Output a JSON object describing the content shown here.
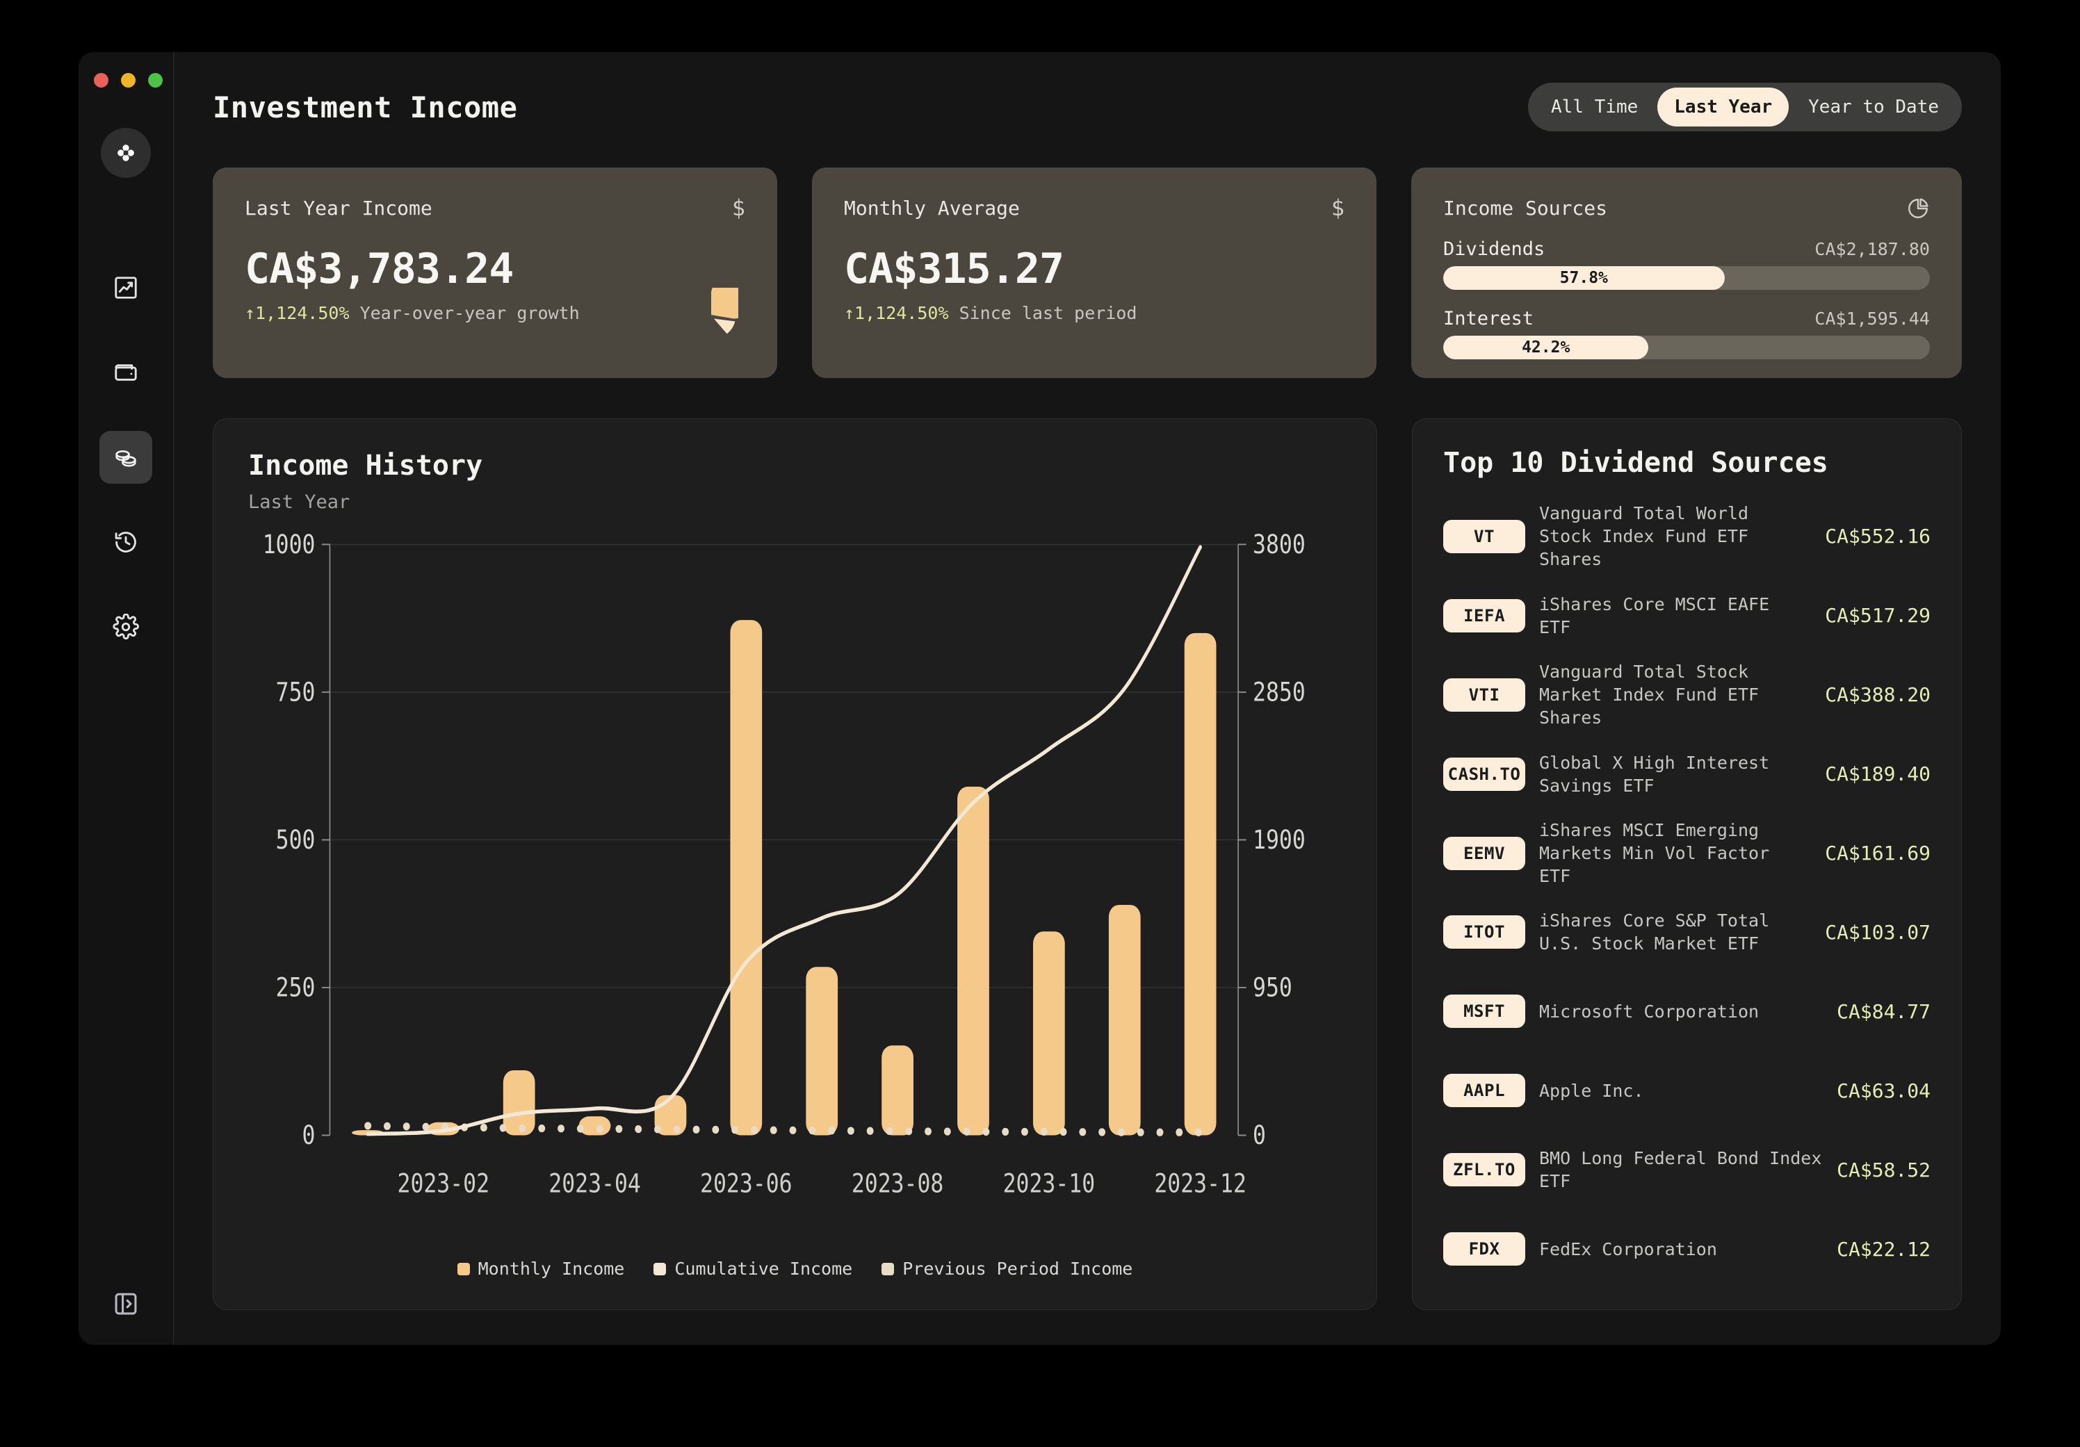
{
  "window": {
    "traffic_lights": [
      "close",
      "minimize",
      "maximize"
    ],
    "colors": {
      "close": "#e8625a",
      "minimize": "#f0b429",
      "maximize": "#4cc247"
    }
  },
  "sidebar": {
    "logo_icon": "clover-logo-icon",
    "items": [
      {
        "icon": "chart-trending-up-icon",
        "name": "performance",
        "active": false
      },
      {
        "icon": "wallet-icon",
        "name": "accounts",
        "active": false
      },
      {
        "icon": "coins-icon",
        "name": "income",
        "active": true
      },
      {
        "icon": "history-clock-icon",
        "name": "history",
        "active": false
      },
      {
        "icon": "gear-icon",
        "name": "settings",
        "active": false
      }
    ],
    "collapse_icon": "panel-expand-icon"
  },
  "header": {
    "title": "Investment Income",
    "range_options": [
      {
        "label": "All Time",
        "active": false
      },
      {
        "label": "Last Year",
        "active": true
      },
      {
        "label": "Year to Date",
        "active": false
      }
    ]
  },
  "stats": {
    "last_year_income": {
      "label": "Last Year Income",
      "icon": "dollar-sign-icon",
      "value": "CA$3,783.24",
      "delta": "↑1,124.50%",
      "delta_text": "Year-over-year growth"
    },
    "monthly_average": {
      "label": "Monthly Average",
      "icon": "dollar-sign-icon",
      "value": "CA$315.27",
      "delta": "↑1,124.50%",
      "delta_text": "Since last period"
    },
    "income_sources": {
      "label": "Income Sources",
      "icon": "pie-chart-icon",
      "rows": [
        {
          "name": "Dividends",
          "amount": "CA$2,187.80",
          "percent_label": "57.8%",
          "percent": 57.8
        },
        {
          "name": "Interest",
          "amount": "CA$1,595.44",
          "percent_label": "42.2%",
          "percent": 42.2
        }
      ]
    }
  },
  "income_history": {
    "title": "Income History",
    "subtitle": "Last Year"
  },
  "chart_data": {
    "type": "bar",
    "title": "Income History",
    "subtitle": "Last Year",
    "xlabel": "",
    "ylabel": "",
    "grid": true,
    "legend_position": "bottom",
    "x": [
      "2023-01",
      "2023-02",
      "2023-03",
      "2023-04",
      "2023-05",
      "2023-06",
      "2023-07",
      "2023-08",
      "2023-09",
      "2023-10",
      "2023-11",
      "2023-12"
    ],
    "tick_labels_x": [
      "2023-02",
      "2023-04",
      "2023-06",
      "2023-08",
      "2023-10",
      "2023-12"
    ],
    "left_axis": {
      "ticks": [
        0,
        250,
        500,
        750,
        1000
      ],
      "min": 0,
      "max": 1000
    },
    "right_axis": {
      "ticks": [
        0,
        950,
        1900,
        2850,
        3800
      ],
      "min": 0,
      "max": 3800
    },
    "series": [
      {
        "name": "Monthly Income",
        "type": "bar",
        "axis": "left",
        "color": "#f5c98a",
        "values": [
          8,
          22,
          110,
          32,
          68,
          872,
          285,
          152,
          590,
          345,
          390,
          850
        ]
      },
      {
        "name": "Cumulative Income",
        "type": "line",
        "axis": "right",
        "color": "#f2e8d5",
        "values": [
          8,
          30,
          140,
          172,
          240,
          1112,
          1397,
          1549,
          2139,
          2484,
          2874,
          3783
        ]
      },
      {
        "name": "Previous Period Income",
        "type": "dotted-line",
        "axis": "left",
        "color": "#e9dcc6",
        "values": [
          16,
          14,
          12,
          11,
          10,
          9,
          8,
          7,
          6,
          6,
          5,
          5
        ]
      }
    ],
    "legend": [
      {
        "label": "Monthly Income",
        "color": "#f5c98a"
      },
      {
        "label": "Cumulative Income",
        "color": "#f2e8d5"
      },
      {
        "label": "Previous Period Income",
        "color": "#e9dcc6"
      }
    ]
  },
  "top_dividends": {
    "title": "Top 10 Dividend Sources",
    "rows": [
      {
        "ticker": "VT",
        "name": "Vanguard Total World Stock Index Fund ETF Shares",
        "amount": "CA$552.16"
      },
      {
        "ticker": "IEFA",
        "name": "iShares Core MSCI EAFE ETF",
        "amount": "CA$517.29"
      },
      {
        "ticker": "VTI",
        "name": "Vanguard Total Stock Market Index Fund ETF Shares",
        "amount": "CA$388.20"
      },
      {
        "ticker": "CASH.TO",
        "name": "Global X High Interest Savings ETF",
        "amount": "CA$189.40"
      },
      {
        "ticker": "EEMV",
        "name": "iShares MSCI Emerging Markets Min Vol Factor ETF",
        "amount": "CA$161.69"
      },
      {
        "ticker": "ITOT",
        "name": "iShares Core S&P Total U.S. Stock Market ETF",
        "amount": "CA$103.07"
      },
      {
        "ticker": "MSFT",
        "name": "Microsoft Corporation",
        "amount": "CA$84.77"
      },
      {
        "ticker": "AAPL",
        "name": "Apple Inc.",
        "amount": "CA$63.04"
      },
      {
        "ticker": "ZFL.TO",
        "name": "BMO Long Federal Bond Index ETF",
        "amount": "CA$58.52"
      },
      {
        "ticker": "FDX",
        "name": "FedEx Corporation",
        "amount": "CA$22.12"
      }
    ]
  }
}
